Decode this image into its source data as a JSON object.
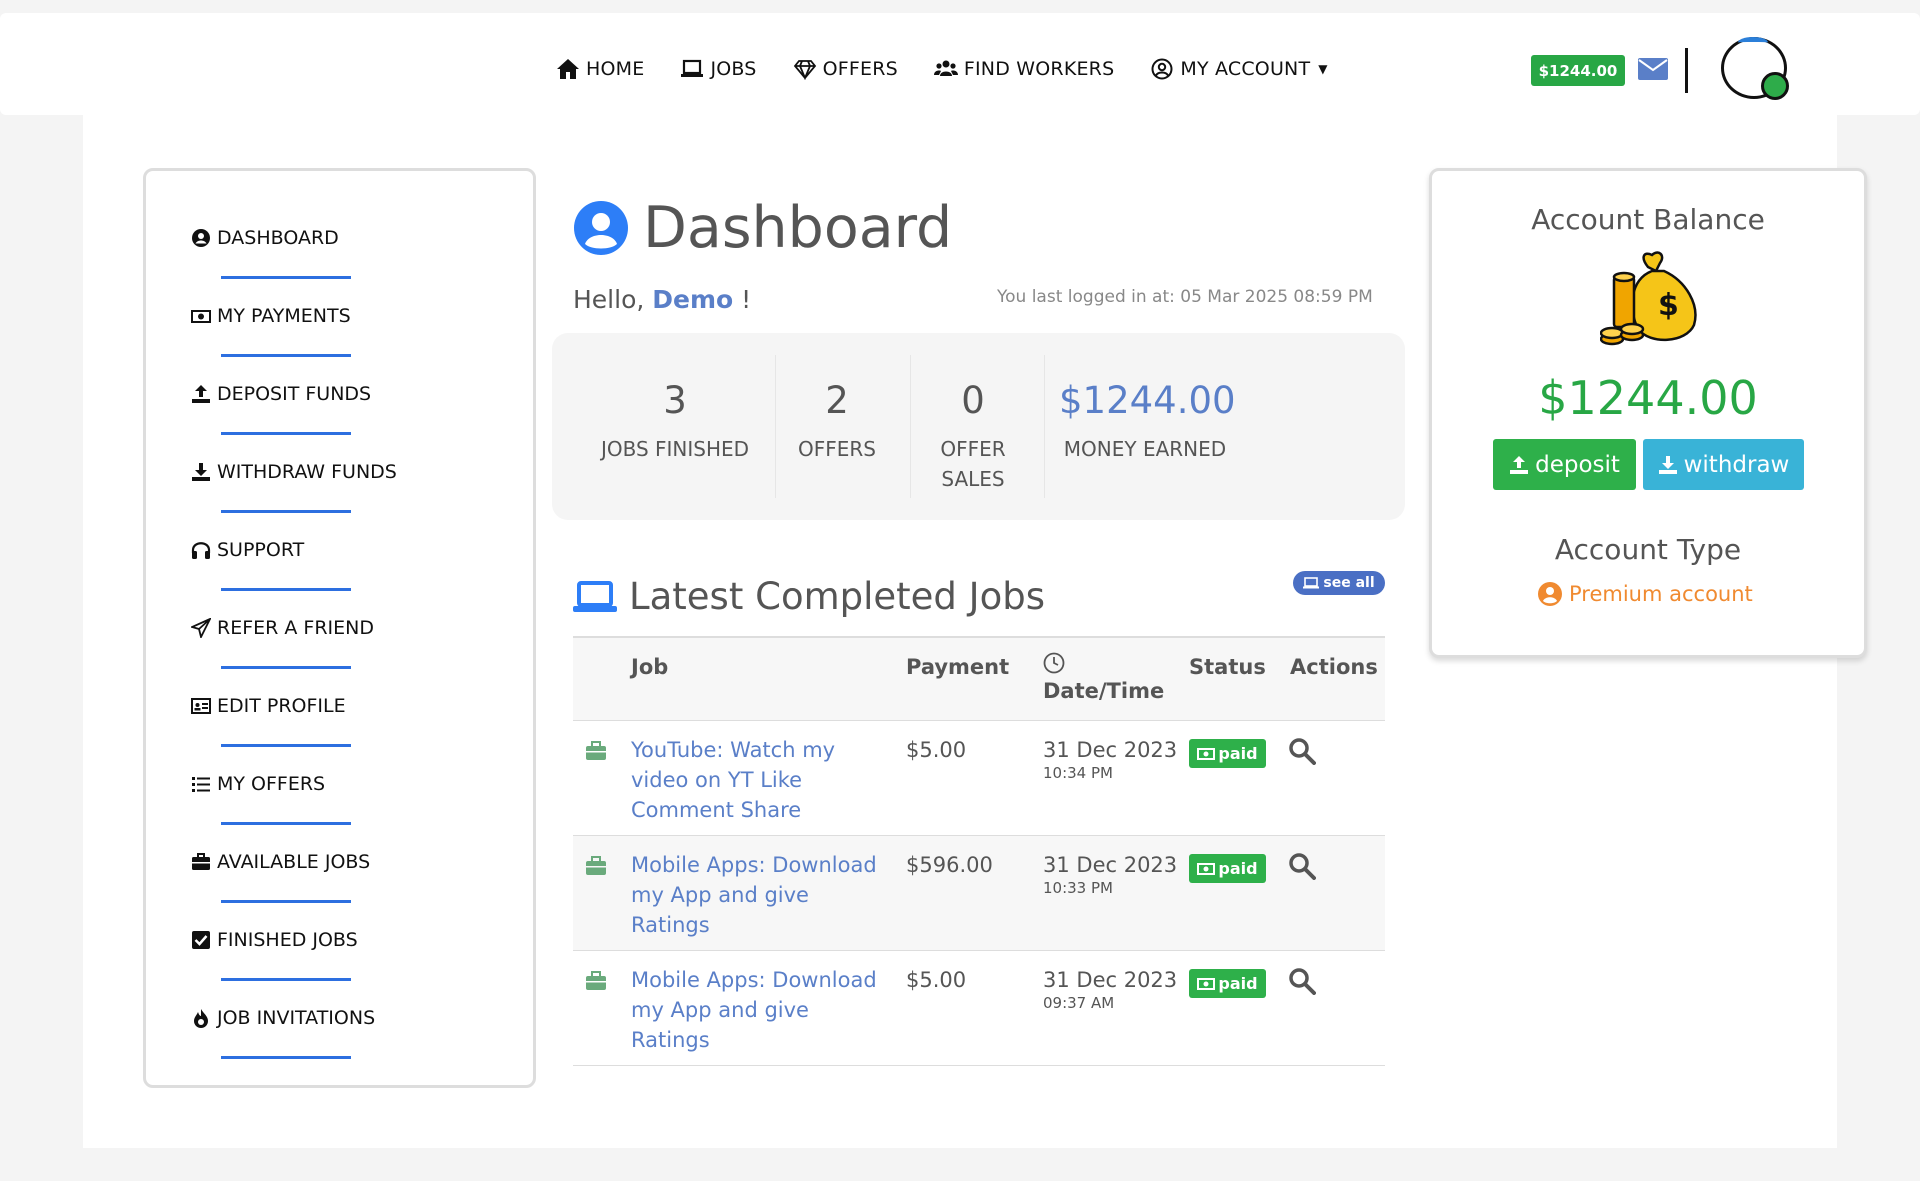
{
  "nav": {
    "items": [
      {
        "label": "HOME",
        "icon": "home-icon"
      },
      {
        "label": "JOBS",
        "icon": "laptop-icon"
      },
      {
        "label": "OFFERS",
        "icon": "diamond-icon"
      },
      {
        "label": "FIND WORKERS",
        "icon": "users-icon"
      },
      {
        "label": "MY ACCOUNT",
        "icon": "user-circle-icon"
      }
    ],
    "balance": "$1244.00"
  },
  "sidebar": {
    "items": [
      {
        "label": "DASHBOARD",
        "icon": "user-circle-icon"
      },
      {
        "label": "MY PAYMENTS",
        "icon": "money-bill-icon"
      },
      {
        "label": "DEPOSIT FUNDS",
        "icon": "upload-icon"
      },
      {
        "label": "WITHDRAW FUNDS",
        "icon": "download-icon"
      },
      {
        "label": "SUPPORT",
        "icon": "headphones-icon"
      },
      {
        "label": "REFER A FRIEND",
        "icon": "paper-plane-icon"
      },
      {
        "label": "EDIT PROFILE",
        "icon": "id-card-icon"
      },
      {
        "label": "MY OFFERS",
        "icon": "list-icon"
      },
      {
        "label": "AVAILABLE JOBS",
        "icon": "briefcase-icon"
      },
      {
        "label": "FINISHED JOBS",
        "icon": "check-square-icon"
      },
      {
        "label": "JOB INVITATIONS",
        "icon": "fire-icon"
      }
    ]
  },
  "dashboard": {
    "title": "Dashboard",
    "hello_prefix": "Hello,",
    "username": "Demo",
    "hello_suffix": "!",
    "last_login": "You last logged in at: 05 Mar 2025 08:59 PM",
    "stats": [
      {
        "value": "3",
        "label": "JOBS FINISHED"
      },
      {
        "value": "2",
        "label": "OFFERS"
      },
      {
        "value": "0",
        "label": "OFFER SALES"
      },
      {
        "value": "$1244.00",
        "label": "MONEY EARNED"
      }
    ]
  },
  "latest": {
    "title": "Latest Completed Jobs",
    "see_all": "see all",
    "columns": {
      "job": "Job",
      "payment": "Payment",
      "datetime": "Date/Time",
      "status": "Status",
      "actions": "Actions"
    },
    "rows": [
      {
        "job": "YouTube: Watch my video on YT Like Comment Share",
        "payment": "$5.00",
        "date": "31 Dec 2023",
        "time": "10:34 PM",
        "status": "paid"
      },
      {
        "job": "Mobile Apps: Download my App and give Ratings",
        "payment": "$596.00",
        "date": "31 Dec 2023",
        "time": "10:33 PM",
        "status": "paid"
      },
      {
        "job": "Mobile Apps: Download my App and give Ratings",
        "payment": "$5.00",
        "date": "31 Dec 2023",
        "time": "09:37 AM",
        "status": "paid"
      }
    ]
  },
  "account": {
    "balance_title": "Account Balance",
    "balance": "$1244.00",
    "deposit_label": "deposit",
    "withdraw_label": "withdraw",
    "type_title": "Account Type",
    "type_value": "Premium account"
  },
  "colors": {
    "accent": "#5a7fc8",
    "green": "#28a745",
    "info": "#39b3d7",
    "orange": "#f08a30",
    "blue_line": "#2d6fe0"
  }
}
